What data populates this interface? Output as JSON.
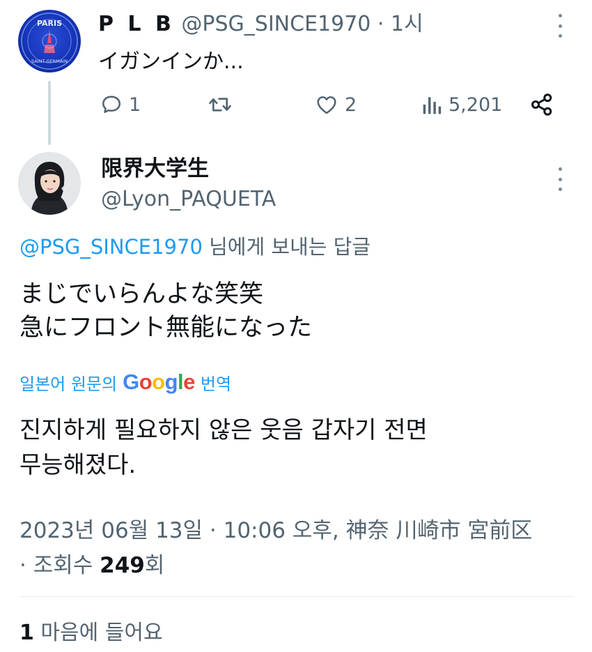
{
  "parent_tweet": {
    "display_name": "P L B",
    "handle": "@PSG_SINCE1970",
    "separator": "·",
    "time": "1시",
    "text": "イガンインか...",
    "avatar_text": {
      "top": "PARIS",
      "bottom": "SAINT-GERMAIN"
    },
    "actions": {
      "reply_count": "1",
      "retweet_count": "",
      "like_count": "2",
      "view_count": "5,201"
    }
  },
  "tweet": {
    "display_name": "限界大学生",
    "handle": "@Lyon_PAQUETA",
    "replying_to": {
      "mention": "@PSG_SINCE1970",
      "suffix": " 님에게 보내는 답글"
    },
    "text_lines": [
      "まじでいらんよな笑笑",
      "急にフロント無能になった"
    ],
    "translation": {
      "prefix": "일본어 원문의",
      "provider": "Google",
      "suffix": "번역",
      "lines": [
        "진지하게 필요하지 않은 웃음 갑자기 전면",
        "무능해졌다."
      ]
    },
    "meta": {
      "line1": "2023년 06월 13일 · 10:06 오후, 神奈 川崎市 宮前区",
      "views_prefix": "· 조회수 ",
      "views_count": "249",
      "views_suffix": "회"
    },
    "likes": {
      "count": "1",
      "label": " 마음에 들어요"
    }
  },
  "icons": {
    "reply": "speech-bubble-icon",
    "retweet": "retweet-icon",
    "like": "heart-icon",
    "views": "bar-chart-icon",
    "share": "share-icon",
    "more": "more-vertical-icon"
  },
  "colors": {
    "accent": "#1d9bf0",
    "secondary_text": "#536471",
    "primary_text": "#0f1419",
    "thread_line": "#cfd9de"
  }
}
